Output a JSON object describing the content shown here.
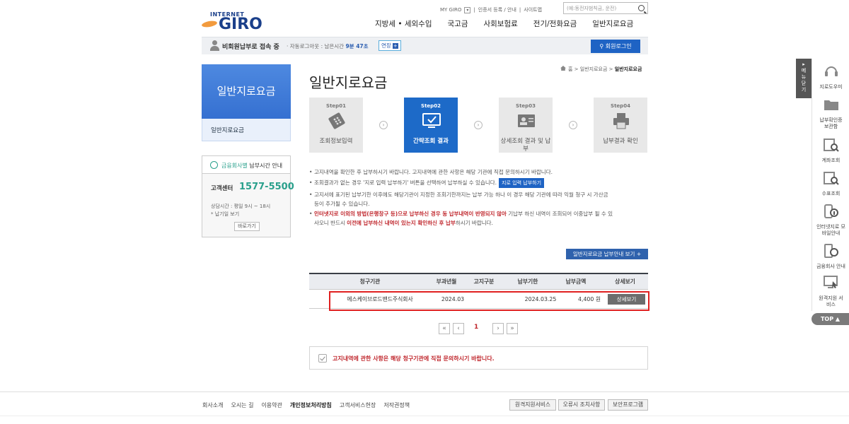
{
  "header": {
    "logo_top": "INTERNET",
    "logo_main": "GIRO",
    "util_links": [
      "MY GIRO",
      "인증서 등록 / 안내",
      "사이트맵"
    ],
    "search_placeholder": "(예:동전자범칙금, 운전)",
    "gnb": [
      "지방세 • 세외수입",
      "국고금",
      "사회보험료",
      "전기/전화요금",
      "일반지로요금"
    ]
  },
  "login_bar": {
    "status": "비회원납부로 접속 중",
    "auto_logout_label": "자동로그아웃 : 남은시간",
    "remaining": "9분 47초",
    "extend": "연장",
    "member_login": "회원로그인"
  },
  "left_nav": {
    "title": "일반지로요금",
    "item": "일반지로요금",
    "time_notice_pre": "금융회사별",
    "time_notice_post": "납부시간 안내",
    "customer_center_label": "고객센터",
    "customer_center_phone": "1577-5500",
    "hours": "상담시간 : 평일 9시 ~ 18시",
    "holiday": "* 납기일 보기",
    "shortcut": "바로가기"
  },
  "page": {
    "title": "일반지로요금",
    "breadcrumb": [
      "홈",
      "일반지로요금",
      "일반지로요금"
    ]
  },
  "steps": [
    {
      "num": "Step01",
      "label": "조회정보입력",
      "active": false
    },
    {
      "num": "Step02",
      "label": "간략조회 결과",
      "active": true
    },
    {
      "num": "Step03",
      "label": "상세조회 결과 및 납부",
      "active": false
    },
    {
      "num": "Step04",
      "label": "납부결과 확인",
      "active": false
    }
  ],
  "notes": {
    "n1": "고지내역을 확인한 후 납부하시기 바랍니다. 고지내역에 관한 사항은 해당 기관에 직접 문의하시기 바랍니다.",
    "n2": "조회결과가 없는 경우 '지로 입력 납부하기' 버튼을 선택하여 납부하실 수 있습니다.",
    "n2_button": "지로 입력 납부하기",
    "n3a": "고지서에 표기된 납부기한 이후에도 해당기관이 지정한 조회기한까지는 납부 가능 하나 이 경우 해당 기관에 따라 익월 청구 시 가산금",
    "n3b": "등이 추가될 수 있습니다.",
    "n4_red": "인터넷지로 이외의 방법(은행창구 등)으로 납부하신 경우 동 납부내역이 반영되지 않아",
    "n4_rest": " 기납부 하신 내역이 조회되어 이중납부 될 수 있",
    "n5_pre": "사오니 반드시 ",
    "n5_red": "이전에 납부하신 내역이 있는지 확인하신 후 납부",
    "n5_post": "하시기 바랍니다."
  },
  "guide_button": "일반지로요금 납부안내 보기  +",
  "table": {
    "headers": [
      "청구기관",
      "부과년월",
      "고지구분",
      "납부기한",
      "납부금액",
      "상세보기"
    ],
    "rows": [
      {
        "agency": "에스케이브로드밴드주식회사",
        "period": "2024.03",
        "type": "",
        "due": "2024.03.25",
        "amount": "4,400 원",
        "detail": "상세보기"
      }
    ]
  },
  "pagination": {
    "first": "«",
    "prev": "‹",
    "current": "1",
    "next": "›",
    "last": "»"
  },
  "notice": "고지내역에 관한 사항은 해당 청구기관에 직접 문의하시기 바랍니다.",
  "footer": {
    "links": [
      "회사소개",
      "오시는 길",
      "이용약관",
      "개인정보처리방침",
      "고객서비스헌장",
      "저작권정책"
    ],
    "buttons": [
      "원격지원서비스",
      "오류시 조치사항",
      "보안프로그램"
    ]
  },
  "quick_menu": {
    "handle": "메뉴닫기",
    "items": [
      "지로도우미",
      "납부확인증 보관함",
      "계좌조회",
      "수표조회",
      "인터넷지로 모바일안내",
      "금융회사 안내",
      "원격지원 서비스"
    ],
    "top": "TOP"
  },
  "colors": {
    "primary": "#1e63c4",
    "accent_red": "#c0282e",
    "green": "#2aa08c",
    "highlight": "#e02020"
  }
}
